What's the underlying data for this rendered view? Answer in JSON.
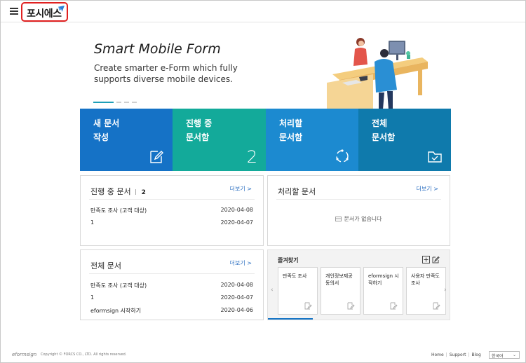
{
  "header": {
    "menu_icon": "hamburger-menu-icon",
    "logo_text": "포시에스",
    "logo_mark_color": "#2b7dd6"
  },
  "hero": {
    "title": "Smart Mobile Form",
    "subtitle": "Create smarter e-Form which fully supports diverse mobile devices.",
    "slide_count": 4,
    "active_slide": 1
  },
  "tiles": [
    {
      "label_line1": "새 문서",
      "label_line2": "작성",
      "icon": "pen-document-icon",
      "color": "#1572c6"
    },
    {
      "label_line1": "진행 중",
      "label_line2": "문서함",
      "count": "2",
      "color": "#13aa9a"
    },
    {
      "label_line1": "처리할",
      "label_line2": "문서함",
      "icon": "refresh-cycle-icon",
      "color": "#1c8ad0"
    },
    {
      "label_line1": "전체",
      "label_line2": "문서함",
      "icon": "folder-check-icon",
      "color": "#0f7aac"
    }
  ],
  "in_progress_panel": {
    "title": "진행 중 문서",
    "count": "2",
    "more_label": "더보기 >",
    "rows": [
      {
        "name": "만족도 조사 (고객 대상)",
        "date": "2020-04-08"
      },
      {
        "name": "1",
        "date": "2020-04-07"
      }
    ]
  },
  "todo_panel": {
    "title": "처리할 문서",
    "more_label": "더보기 >",
    "empty_text": "문서가 없습니다"
  },
  "all_docs_panel": {
    "title": "전체 문서",
    "more_label": "더보기 >",
    "rows": [
      {
        "name": "만족도 조사 (고객 대상)",
        "date": "2020-04-08"
      },
      {
        "name": "1",
        "date": "2020-04-07"
      },
      {
        "name": "eformsign 시작하기",
        "date": "2020-04-06"
      }
    ]
  },
  "favorites": {
    "title": "즐겨찾기",
    "add_icon": "add-box-icon",
    "edit_icon": "edit-pencil-icon",
    "cards": [
      {
        "label": "만족도 조사"
      },
      {
        "label": "개인정보제공동의서"
      },
      {
        "label": "eformsign 시작하기"
      },
      {
        "label": "사용자 만족도 조사"
      }
    ],
    "prev_icon": "chevron-left-icon",
    "next_icon": "chevron-right-icon"
  },
  "footer": {
    "logo": "eformsign",
    "copyright": "Copyright © FORCS CO., LTD. All rights reserved.",
    "links": [
      "Home",
      "Support",
      "Blog"
    ],
    "language": "한국어"
  }
}
